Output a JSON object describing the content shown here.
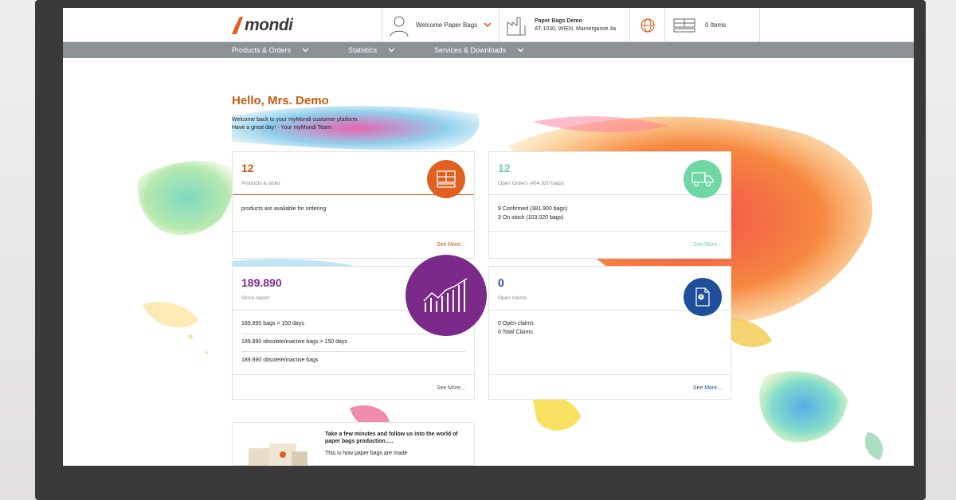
{
  "header": {
    "logo_text": "mondi",
    "welcome": "Welcome Paper Bags",
    "company_name": "Paper Bags Demo",
    "company_address": "AT-1030, WIEN, Marxergasse 4a",
    "cart_count": "0 Items",
    "icons": [
      "user-icon",
      "chevron-down-icon",
      "factory-icon",
      "globe-icon",
      "pallet-cart-icon"
    ]
  },
  "nav": {
    "items": [
      {
        "label": "Products & Orders"
      },
      {
        "label": "Statistics"
      },
      {
        "label": "Services & Downloads"
      }
    ]
  },
  "greeting": {
    "title": "Hello, Mrs. Demo",
    "line1": "Welcome back to your myMondi customer platform.",
    "line2": "Have a great day! - Your myMondi Team"
  },
  "cards": {
    "products": {
      "value": "12",
      "label": "Products & order",
      "line1": "products are available for ordering",
      "more": "See More...",
      "color": "#e0601f",
      "icon": "pallet-icon"
    },
    "open_orders": {
      "value": "12",
      "label": "Open Orders (484.920 bags)",
      "line1": "9 Confirmed (381.900 bags)",
      "line2": "3 On stock (103.020 bags)",
      "more": "See More...",
      "color": "#6fd6a4",
      "icon": "truck-icon"
    },
    "stock": {
      "value": "189.890",
      "label": "Stock report",
      "line1": "189.890 bags > 150 days",
      "line2": "189.890 obsolete/inactive bags > 150 days",
      "line3": "189.890 obsolete/inactive bags",
      "more": "See More...",
      "color": "#7b2a8a",
      "icon": "bar-chart-icon"
    },
    "claims": {
      "value": "0",
      "label": "Open claims",
      "line1": "0 Open claims",
      "line2": "0 Total Claims",
      "more": "See More...",
      "color": "#1f4f9a",
      "icon": "document-icon"
    }
  },
  "promo": {
    "title": "Take a few minutes and follow us into the world of paper bags production.....",
    "subtitle": "This is how paper bags are made"
  }
}
